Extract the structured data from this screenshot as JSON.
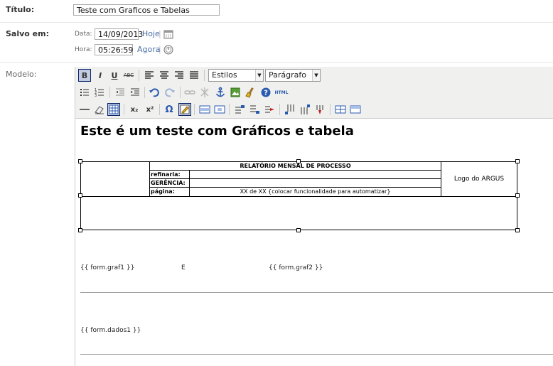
{
  "fields": {
    "titulo_label": "Título:",
    "titulo_value": "Teste com Graficos e Tabelas",
    "salvo_label": "Salvo em:",
    "data_label": "Data:",
    "data_value": "14/09/2013",
    "hoje_link": "Hoje",
    "hora_label": "Hora:",
    "hora_value": "05:26:59",
    "agora_link": "Agora",
    "modelo_label": "Modelo:"
  },
  "toolbar": {
    "bold": "B",
    "italic": "I",
    "underline": "U",
    "strike": "ABC",
    "styles_select": "Estilos",
    "format_select": "Parágrafo",
    "html_label": "HTML",
    "sub_label": "x₂",
    "sup_label": "x²",
    "omega_label": "Ω"
  },
  "document": {
    "heading": "Este é um teste com Gráficos e tabela",
    "report_title": "RELATÓRIO MENSAL DE PROCESSO",
    "refinaria": "refinaria:",
    "gerencia": "GERÊNCIA:",
    "pagina": "página:",
    "pagina_value": "XX de XX {colocar funcionalidade para automatizar}",
    "logo": "Logo do ARGUS",
    "graf1": "{{ form.graf1 }}",
    "e_text": "E",
    "graf2": "{{ form.graf2 }}",
    "dados1": "{{ form.dados1 }}"
  }
}
